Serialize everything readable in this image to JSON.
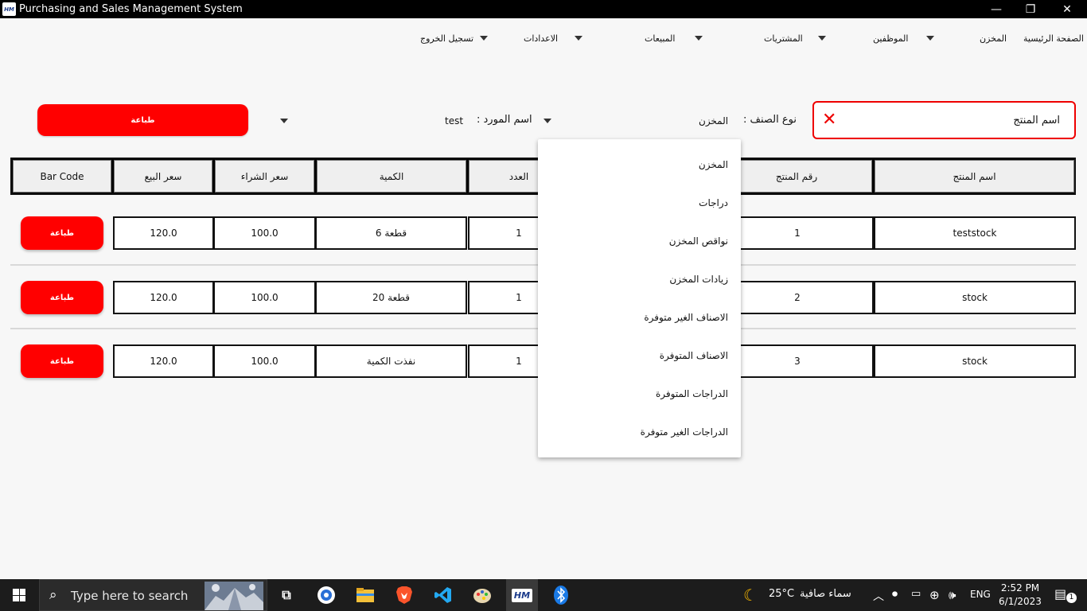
{
  "window": {
    "icon_text": "HM",
    "title": "Purchasing and Sales Management System",
    "minimize": "—",
    "restore": "❐",
    "close": "✕"
  },
  "menu": {
    "home": "الصفحة الرئيسية",
    "store": "المخزن",
    "employees": "الموظفين",
    "purchases": "المشتريات",
    "sales": "المبيعات",
    "settings": "الاعدادات",
    "logout": "تسجيل الخروج"
  },
  "filters": {
    "print_label": "طباعة",
    "supplier_label": "اسم المورد :",
    "supplier_value": "test",
    "category_label": "نوع الصنف :",
    "category_value": "المخزن",
    "search_value": "اسم المنتج",
    "clear_icon": "✕"
  },
  "table": {
    "headers": {
      "barcode": "Bar Code",
      "sell_price": "سعر البيع",
      "buy_price": "سعر الشراء",
      "quantity": "الكمية",
      "count": "العدد",
      "product_no": "رقم المنتج",
      "product_name": "اسم المنتج"
    },
    "print_label": "طباعة",
    "rows": [
      {
        "sell": "120.0",
        "buy": "100.0",
        "qty": "6 قطعة",
        "count": "1",
        "no": "1",
        "name": "teststock"
      },
      {
        "sell": "120.0",
        "buy": "100.0",
        "qty": "20 قطعة",
        "count": "1",
        "no": "2",
        "name": "stock"
      },
      {
        "sell": "120.0",
        "buy": "100.0",
        "qty": "نفذت الكمية",
        "count": "1",
        "no": "3",
        "name": "stock"
      }
    ]
  },
  "dropdown": {
    "options": [
      "المخزن",
      "دراجات",
      "نواقص المخزن",
      "زيادات المخزن",
      "الاصناف الغير متوفرة",
      "الاصناف المتوفرة",
      "الدراجات المتوفرة",
      "الدراجات الغير متوفرة"
    ]
  },
  "taskbar": {
    "search_placeholder": "Type here to search",
    "weather_temp": "25°C",
    "weather_desc": "سماء صافية",
    "language": "ENG",
    "time": "2:52 PM",
    "date": "6/1/2023",
    "notification_count": "1",
    "hm_app": "HM"
  },
  "colors": {
    "accent_red": "#ff0000",
    "titlebar": "#000000",
    "taskbar": "#1c1c1c"
  }
}
